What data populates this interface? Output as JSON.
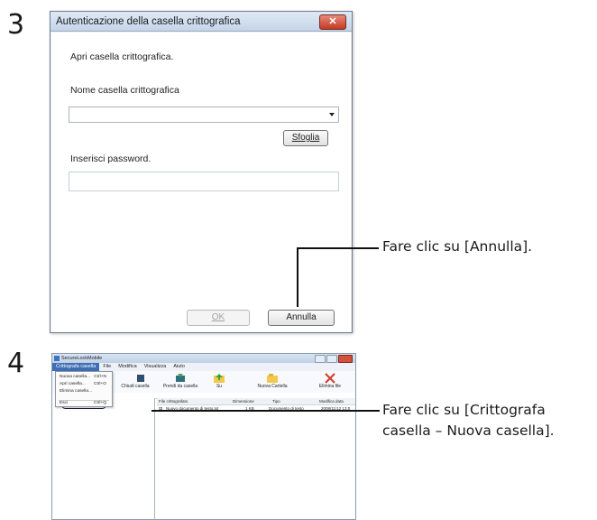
{
  "steps": {
    "step3": "3",
    "step4": "4"
  },
  "dialog": {
    "title": "Autenticazione della casella crittografica",
    "close": "✕",
    "intro": "Apri casella crittografica.",
    "name_label": "Nome casella crittografica",
    "name_value": "",
    "browse_button": "Sfoglia",
    "password_label": "Inserisci password.",
    "password_value": "",
    "ok_button": "OK",
    "cancel_button": "Annulla"
  },
  "callouts": {
    "cancel": "Fare clic su [Annulla].",
    "new_box_line1": "Fare clic su [Crittografa",
    "new_box_line2": "casella – Nuova casella]."
  },
  "app": {
    "title": "SecureLockMobile",
    "menu": [
      "Crittografa casella",
      "File",
      "Modifica",
      "Visualizza",
      "Aiuto"
    ],
    "dropdown": [
      {
        "label": "Nuova casella...",
        "shortcut": "Ctrl+N"
      },
      {
        "label": "Apri casella...",
        "shortcut": "Ctrl+O"
      },
      {
        "label": "Elimina casella...",
        "shortcut": ""
      },
      {
        "label": "Esci",
        "shortcut": "Ctrl+Q"
      }
    ],
    "toolbar": [
      "Chiudi casella",
      "Prendi da casella",
      "Su",
      "Nuova Cartella",
      "Elimina file"
    ],
    "tree_root": "Casella crittografica",
    "columns": [
      "File crittografato",
      "Dimensione",
      "Tipo",
      "Modifica data"
    ],
    "rows": [
      {
        "name": "Nuovo documento di testo.txt",
        "size": "1 KB",
        "type": "Documento di testo",
        "date": "2008/11/12 13:0"
      }
    ]
  },
  "colors": {
    "accent": "#3d6fb6",
    "close": "#c23a22",
    "dialog_bg": "#f0f0f0"
  }
}
